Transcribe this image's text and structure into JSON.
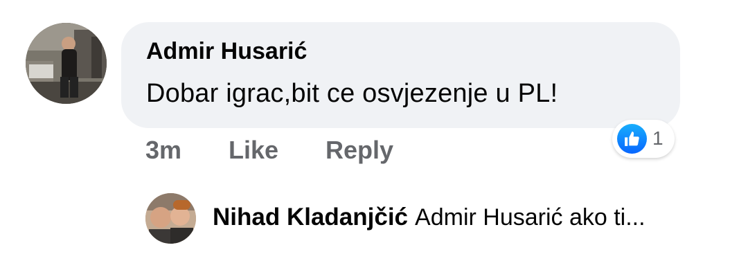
{
  "comment": {
    "author": "Admir Husarić",
    "text": "Dobar igrac,bit ce osvjezenje u PL!",
    "time": "3m",
    "like_label": "Like",
    "reply_label": "Reply",
    "reaction": {
      "icon": "thumbs-up-icon",
      "count": "1",
      "color": "#0866ff"
    }
  },
  "reply": {
    "author": "Nihad Kladanjčić",
    "preview": "Admir Husarić ako ti..."
  },
  "colors": {
    "bubble": "#f0f2f5",
    "text": "#050505",
    "secondary": "#65676b"
  }
}
